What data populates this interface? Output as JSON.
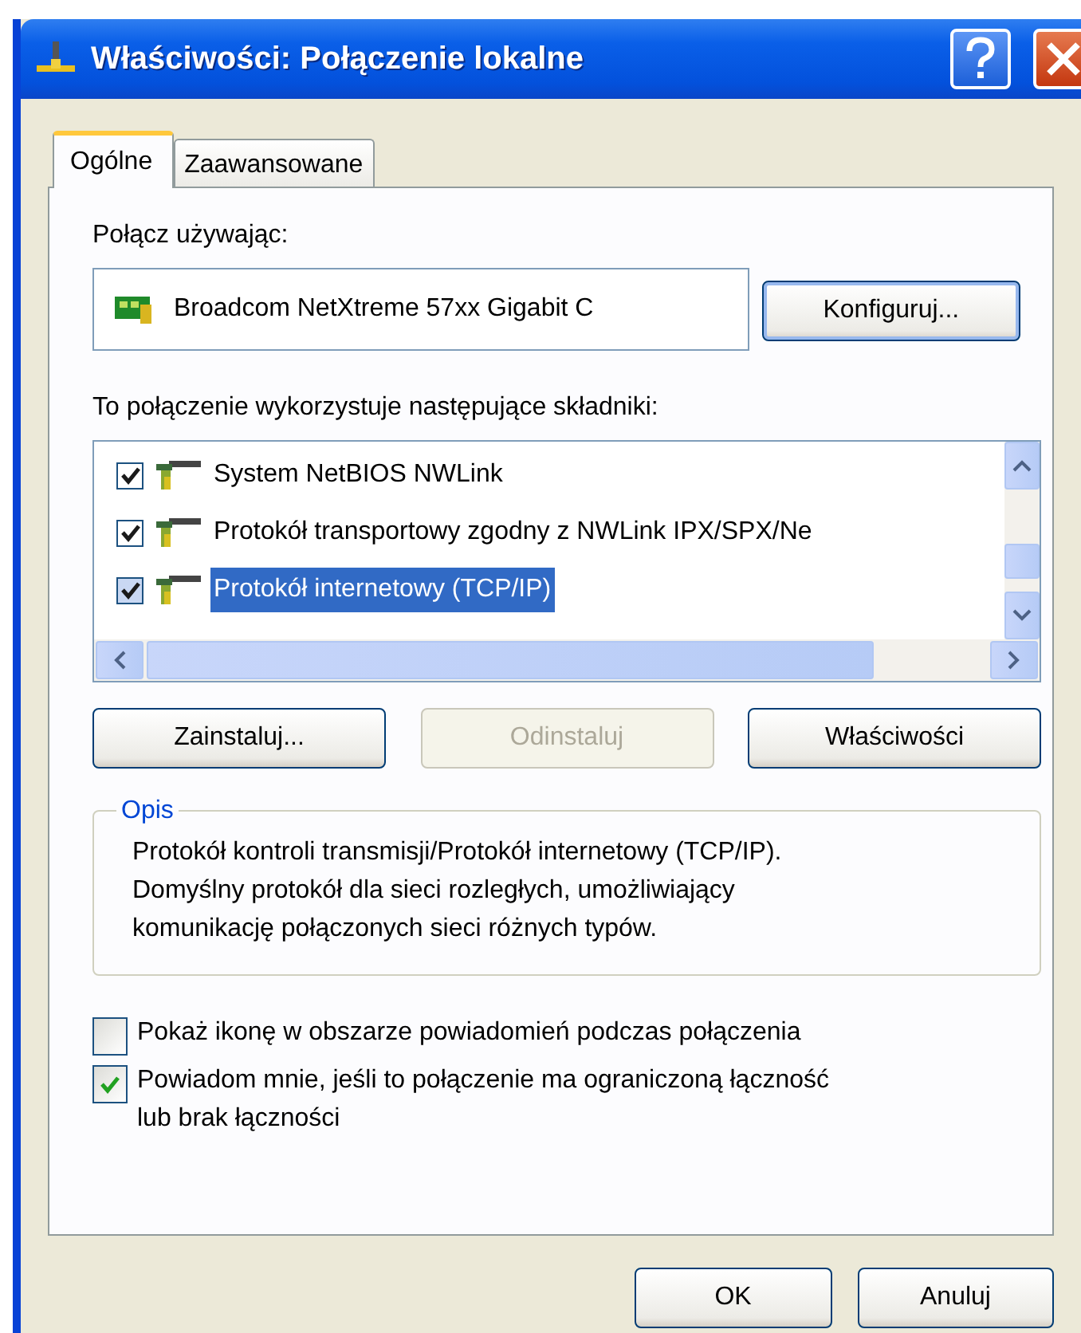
{
  "window": {
    "title": "Właściwości: Połączenie lokalne"
  },
  "tabs": [
    {
      "label": "Ogólne",
      "selected": true
    },
    {
      "label": "Zaawansowane",
      "selected": false
    }
  ],
  "connect_using": {
    "label": "Połącz używając:",
    "adapter": "Broadcom NetXtreme 57xx Gigabit C",
    "configure_button": "Konfiguruj..."
  },
  "components": {
    "label": "To połączenie wykorzystuje następujące składniki:",
    "items": [
      {
        "name": "System NetBIOS NWLink",
        "checked": true,
        "selected": false
      },
      {
        "name": "Protokół transportowy zgodny z NWLink IPX/SPX/Ne",
        "checked": true,
        "selected": false
      },
      {
        "name": "Protokół internetowy (TCP/IP)",
        "checked": true,
        "selected": true
      }
    ],
    "buttons": [
      {
        "label": "Zainstaluj...",
        "disabled": false
      },
      {
        "label": "Odinstaluj",
        "disabled": true
      },
      {
        "label": "Właściwości",
        "disabled": false
      }
    ]
  },
  "description": {
    "legend": "Opis",
    "text": "Protokół kontroli transmisji/Protokół internetowy (TCP/IP).\nDomyślny protokół dla sieci rozległych, umożliwiający\nkomunikację połączonych sieci różnych typów."
  },
  "options": [
    {
      "label": "Pokaż ikonę w obszarze powiadomień podczas połączenia",
      "checked": false
    },
    {
      "label": "Powiadom mnie, jeśli to połączenie ma ograniczoną łączność\nlub brak łączności",
      "checked": true
    }
  ],
  "dialog_buttons": [
    "OK",
    "Anuluj"
  ]
}
